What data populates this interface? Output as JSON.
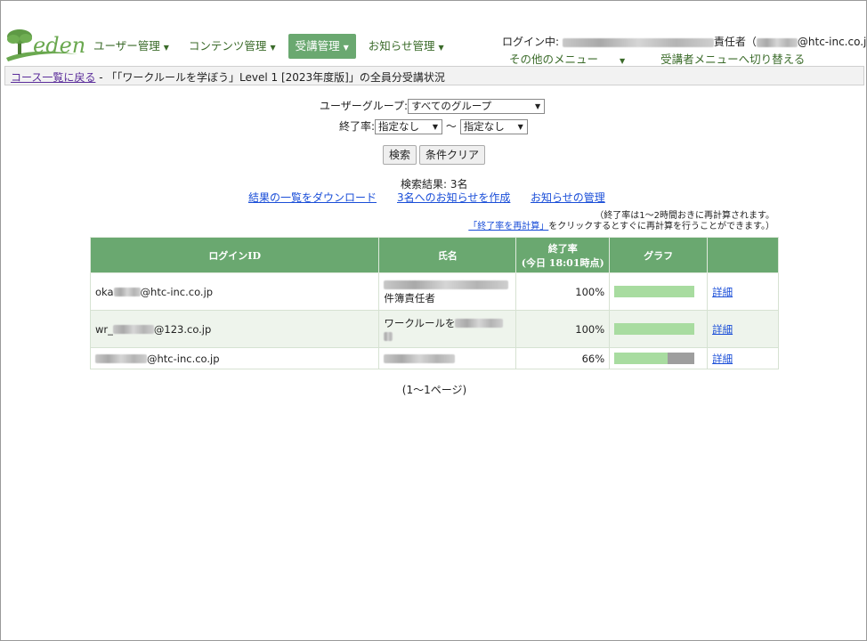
{
  "header": {
    "logo_text": "eden",
    "nav": [
      {
        "label": "ユーザー管理",
        "active": false
      },
      {
        "label": "コンテンツ管理",
        "active": false
      },
      {
        "label": "受講管理",
        "active": true
      },
      {
        "label": "お知らせ管理",
        "active": false
      }
    ],
    "login_prefix": "ログイン中:",
    "login_role": "責任者（",
    "login_email_suffix": "@htc-inc.co.jp）",
    "submenu_other": "その他のメニュー",
    "submenu_switch": "受講者メニューへ切り替える"
  },
  "breadcrumb": {
    "link": "コース一覧に戻る",
    "separator": " - ",
    "title": "「「ワークルールを学ぼう」Level 1 [2023年度版]」の全員分受講状況"
  },
  "filters": {
    "group_label": "ユーザーグループ:",
    "group_value": "すべてのグループ",
    "rate_label": "終了率:",
    "rate_from": "指定なし",
    "rate_sep": "〜",
    "rate_to": "指定なし",
    "search_button": "検索",
    "clear_button": "条件クリア"
  },
  "results": {
    "count": "検索結果: 3名",
    "download_link": "結果の一覧をダウンロード",
    "notify_link": "3名へのお知らせを作成",
    "manage_link": "お知らせの管理",
    "note_line1": "（終了率は1〜2時間おきに再計算されます。",
    "note_link": "「終了率を再計算」",
    "note_line2": "をクリックするとすぐに再計算を行うことができます。）"
  },
  "table": {
    "headers": {
      "login_id": "ログインID",
      "name": "氏名",
      "rate": "終了率",
      "rate_sub": "(今日 18:01時点)",
      "graph": "グラフ",
      "detail": ""
    },
    "rows": [
      {
        "login_prefix": "oka",
        "login_suffix": "@htc-inc.co.jp",
        "name_visible": "件簿責任者",
        "rate": "100%",
        "progress": 1.0,
        "detail": "詳細"
      },
      {
        "login_prefix": "wr_",
        "login_suffix": "@123.co.jp",
        "name_visible": "ワークルールを",
        "rate": "100%",
        "progress": 1.0,
        "detail": "詳細"
      },
      {
        "login_prefix": "",
        "login_suffix": "@htc-inc.co.jp",
        "name_visible": "",
        "rate": "66%",
        "progress": 0.66,
        "detail": "詳細"
      }
    ]
  },
  "pager": "(1〜1ページ)",
  "colors": {
    "accent": "#6aa870",
    "bar_fill": "#a8dca0",
    "bar_rest": "#9e9e9e",
    "link": "#1a4ed8"
  }
}
